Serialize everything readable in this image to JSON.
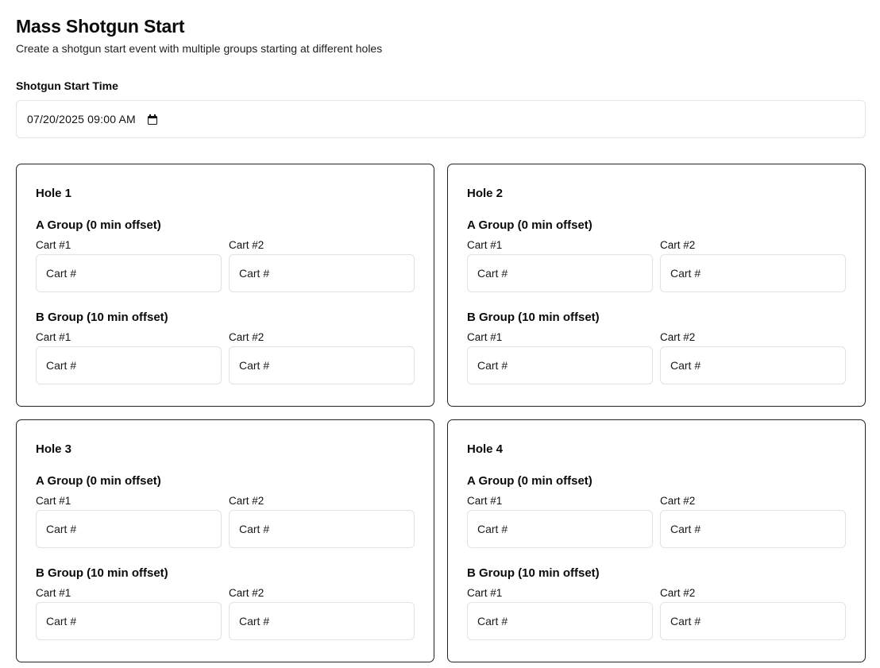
{
  "header": {
    "title": "Mass Shotgun Start",
    "subtitle": "Create a shotgun start event with multiple groups starting at different holes"
  },
  "start_time": {
    "label": "Shotgun Start Time",
    "value": "07/20/2025  09:00  AM",
    "icon": "calendar-icon"
  },
  "cart_placeholder": "Cart #",
  "holes": [
    {
      "title": "Hole 1",
      "groups": [
        {
          "title": "A Group (0 min offset)",
          "cart1_label": "Cart #1",
          "cart2_label": "Cart #2"
        },
        {
          "title": "B Group (10 min offset)",
          "cart1_label": "Cart #1",
          "cart2_label": "Cart #2"
        }
      ]
    },
    {
      "title": "Hole 2",
      "groups": [
        {
          "title": "A Group (0 min offset)",
          "cart1_label": "Cart #1",
          "cart2_label": "Cart #2"
        },
        {
          "title": "B Group (10 min offset)",
          "cart1_label": "Cart #1",
          "cart2_label": "Cart #2"
        }
      ]
    },
    {
      "title": "Hole 3",
      "groups": [
        {
          "title": "A Group (0 min offset)",
          "cart1_label": "Cart #1",
          "cart2_label": "Cart #2"
        },
        {
          "title": "B Group (10 min offset)",
          "cart1_label": "Cart #1",
          "cart2_label": "Cart #2"
        }
      ]
    },
    {
      "title": "Hole 4",
      "groups": [
        {
          "title": "A Group (0 min offset)",
          "cart1_label": "Cart #1",
          "cart2_label": "Cart #2"
        },
        {
          "title": "B Group (10 min offset)",
          "cart1_label": "Cart #1",
          "cart2_label": "Cart #2"
        }
      ]
    }
  ]
}
